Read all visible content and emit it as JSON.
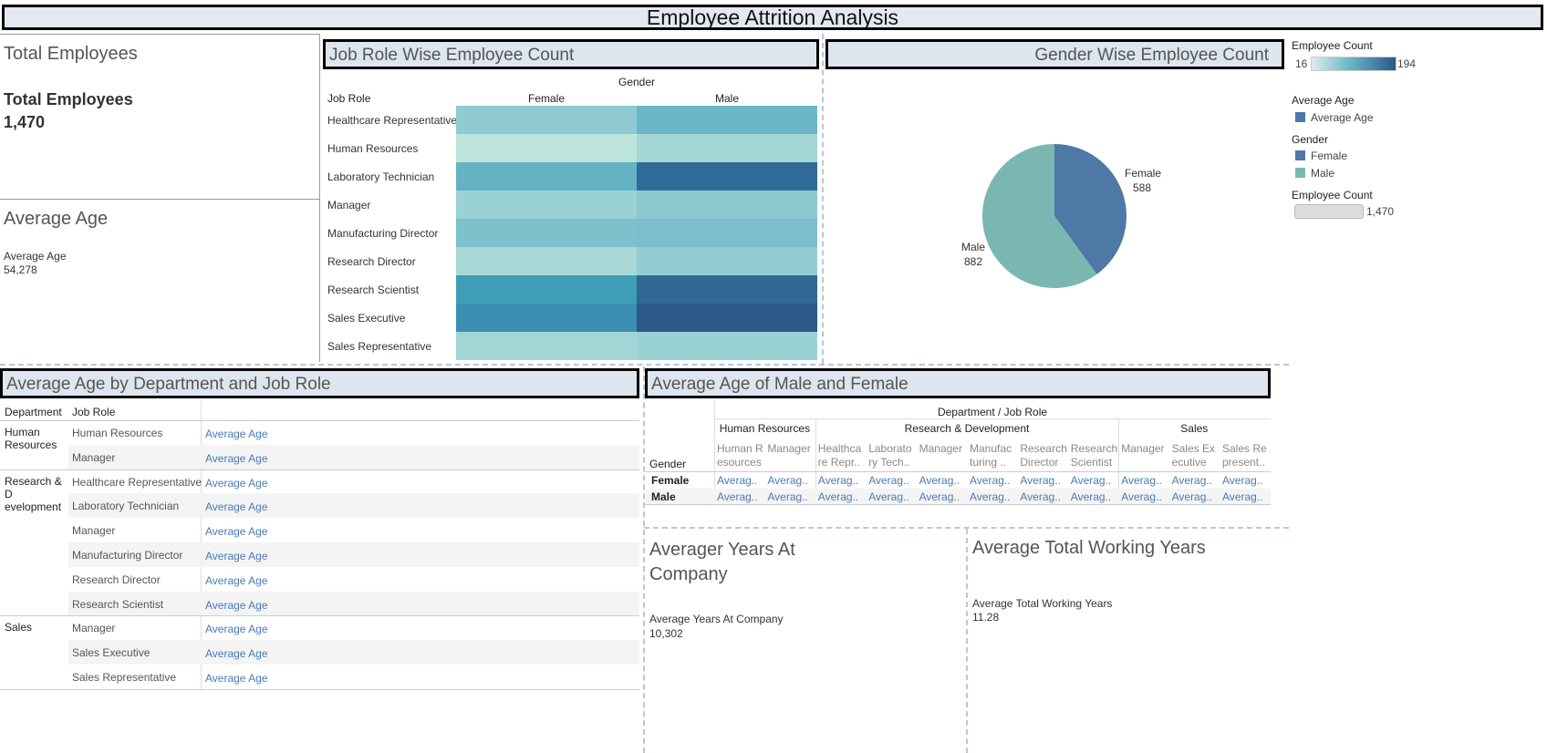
{
  "dashboard_title": "Employee Attrition Analysis",
  "total_employees": {
    "title": "Total Employees",
    "label": "Total Employees",
    "value": "1,470"
  },
  "average_age": {
    "title": "Average Age",
    "label": "Average Age",
    "value": "54,278"
  },
  "job_role_panel": {
    "title": "Job Role Wise Employee Count",
    "col_group": "Gender",
    "row_header": "Job Role",
    "columns": [
      "Female",
      "Male"
    ],
    "rows": [
      "Healthcare Representative",
      "Human Resources",
      "Laboratory Technician",
      "Manager",
      "Manufacturing Director",
      "Research Director",
      "Research Scientist",
      "Sales Executive",
      "Sales Representative"
    ],
    "cell_colors": [
      [
        "#8fcbd0",
        "#6bb7c5"
      ],
      [
        "#bde4dc",
        "#a3d6d5"
      ],
      [
        "#64b3c5",
        "#2e6c97"
      ],
      [
        "#9ad1d5",
        "#8bc8d0"
      ],
      [
        "#7cc1cc",
        "#7abfcb"
      ],
      [
        "#a8d9d6",
        "#92cdd3"
      ],
      [
        "#3f9db8",
        "#2f6893"
      ],
      [
        "#3a8fb3",
        "#2b5989"
      ],
      [
        "#a1d6d6",
        "#98d2d5"
      ]
    ]
  },
  "gender_panel": {
    "title": "Gender Wise Employee Count",
    "slices": [
      {
        "name": "Female",
        "value": 588,
        "color": "#4e78a6"
      },
      {
        "name": "Male",
        "value": 882,
        "color": "#7bb7b2"
      }
    ],
    "labels": [
      "Female",
      "588",
      "Male",
      "882"
    ]
  },
  "legends": {
    "employee_count_title": "Employee Count",
    "employee_count_min": "16",
    "employee_count_max": "194",
    "avg_age_title": "Average Age",
    "avg_age_item": "Average Age",
    "avg_age_color": "#4e78a6",
    "gender_title": "Gender",
    "gender_items": [
      {
        "label": "Female",
        "color": "#4e78a6"
      },
      {
        "label": "Male",
        "color": "#7bb7b2"
      }
    ],
    "size_title": "Employee Count",
    "size_value": "1,470"
  },
  "age_by_dept": {
    "title": "Average Age by Department and Job Role",
    "headers": [
      "Department",
      "Job Role"
    ],
    "groups": [
      {
        "department": "Human\nResources",
        "roles": [
          "Human Resources",
          "Manager"
        ]
      },
      {
        "department": "Research & D\nevelopment",
        "roles": [
          "Healthcare Representative",
          "Laboratory Technician",
          "Manager",
          "Manufacturing Director",
          "Research Director",
          "Research Scientist"
        ]
      },
      {
        "department": "Sales",
        "roles": [
          "Manager",
          "Sales Executive",
          "Sales Representative"
        ]
      }
    ],
    "value_label": "Average Age"
  },
  "age_mf": {
    "title": "Average Age of Male and Female",
    "top_header": "Department / Job Role",
    "row_header": "Gender",
    "departments": [
      {
        "name": "Human Resources",
        "roles": [
          "Human R\nesources",
          "Manager"
        ]
      },
      {
        "name": "Research & Development",
        "roles": [
          "Healthca\nre Repr..",
          "Laborato\nry Tech..",
          "Manager",
          "Manufac\nturing ..",
          "Research\nDirector",
          "Research\nScientist"
        ]
      },
      {
        "name": "Sales",
        "roles": [
          "Manager",
          "Sales Ex\necutive",
          "Sales Re\npresent.."
        ]
      }
    ],
    "rows": [
      "Female",
      "Male"
    ],
    "cell_text": "Averag.."
  },
  "years_at_company": {
    "title": "Averager Years At\nCompany",
    "label": "Average Years At Company",
    "value": "10,302"
  },
  "total_working_years": {
    "title": "Average Total Working Years",
    "label": "Average Total Working Years",
    "value": "11.28"
  }
}
